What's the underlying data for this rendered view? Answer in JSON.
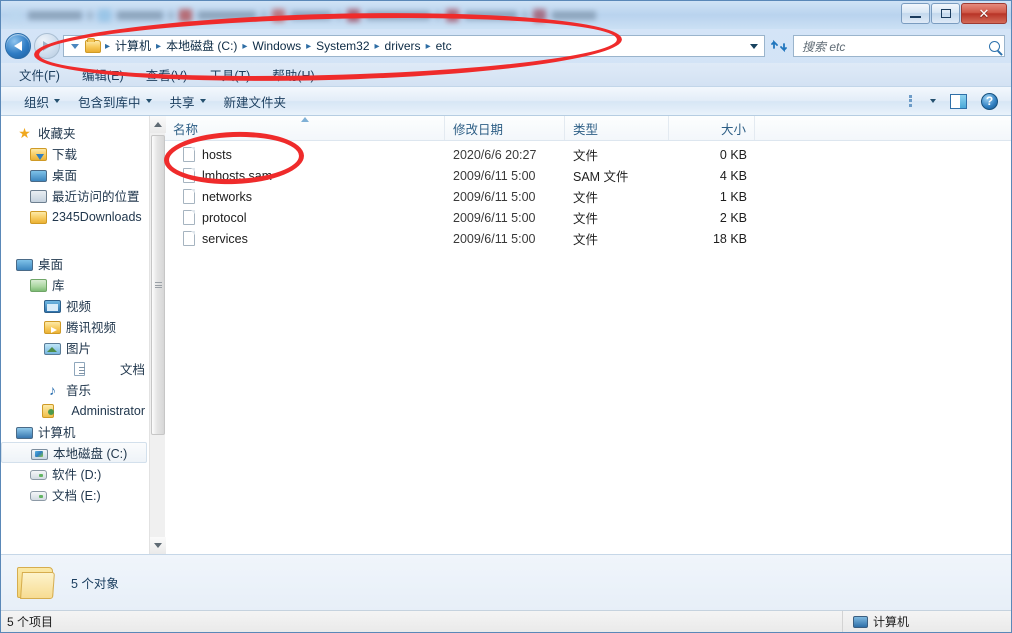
{
  "window": {
    "controls": {
      "minimize": "–",
      "maximize": "□",
      "close": "✕"
    }
  },
  "address": {
    "back_title": "后退",
    "forward_title": "前进",
    "crumbs": [
      "计算机",
      "本地磁盘 (C:)",
      "Windows",
      "System32",
      "drivers",
      "etc"
    ],
    "separator": "▸",
    "refresh_icon": "↻"
  },
  "search": {
    "placeholder": "搜索 etc",
    "icon": "search-icon"
  },
  "menubar": {
    "items": [
      {
        "label": "文件(F)",
        "text": "文件(F)"
      },
      {
        "label": "编辑(E)",
        "text": "编辑(E)"
      },
      {
        "label": "查看(V)",
        "text": "查看(V)"
      },
      {
        "label": "工具(T)",
        "text": "工具(T)"
      },
      {
        "label": "帮助(H)",
        "text": "帮助(H)"
      }
    ]
  },
  "toolbar": {
    "organize": "组织",
    "include_library": "包含到库中",
    "share": "共享",
    "new_folder": "新建文件夹",
    "views_icon": "list-view-icon",
    "preview_icon": "preview-pane-icon",
    "help_icon": "?"
  },
  "navpane": {
    "items": [
      {
        "label": "收藏夹",
        "icon": "star-icon",
        "indent": 10,
        "selected": false
      },
      {
        "label": "下载",
        "icon": "download-folder-icon",
        "indent": 24,
        "selected": false
      },
      {
        "label": "桌面",
        "icon": "desktop-icon",
        "indent": 24,
        "selected": false
      },
      {
        "label": "最近访问的位置",
        "icon": "recent-places-icon",
        "indent": 24,
        "selected": false
      },
      {
        "label": "2345Downloads",
        "icon": "folder-icon",
        "indent": 24,
        "selected": false
      },
      {
        "label": "",
        "icon": "spacer",
        "indent": 0,
        "selected": false
      },
      {
        "label": "桌面",
        "icon": "desktop-icon",
        "indent": 10,
        "selected": false
      },
      {
        "label": "库",
        "icon": "library-folder-icon",
        "indent": 24,
        "selected": false
      },
      {
        "label": "视频",
        "icon": "video-icon",
        "indent": 38,
        "selected": false
      },
      {
        "label": "腾讯视频",
        "icon": "tencent-video-icon",
        "indent": 38,
        "selected": false
      },
      {
        "label": "图片",
        "icon": "pictures-icon",
        "indent": 38,
        "selected": false
      },
      {
        "label": "文档",
        "icon": "documents-icon",
        "indent": 38,
        "selected": false
      },
      {
        "label": "音乐",
        "icon": "music-icon",
        "indent": 38,
        "selected": false
      },
      {
        "label": "Administrator",
        "icon": "user-icon",
        "indent": 24,
        "selected": false
      },
      {
        "label": "计算机",
        "icon": "computer-icon",
        "indent": 10,
        "selected": false
      },
      {
        "label": "本地磁盘 (C:)",
        "icon": "windows-drive-icon",
        "indent": 24,
        "selected": true
      },
      {
        "label": "软件 (D:)",
        "icon": "drive-icon",
        "indent": 24,
        "selected": false
      },
      {
        "label": "文档 (E:)",
        "icon": "drive-icon",
        "indent": 24,
        "selected": false
      }
    ]
  },
  "filelist": {
    "columns": [
      {
        "key": "name",
        "label": "名称",
        "sorted": true
      },
      {
        "key": "date",
        "label": "修改日期",
        "sorted": false
      },
      {
        "key": "type",
        "label": "类型",
        "sorted": false
      },
      {
        "key": "size",
        "label": "大小",
        "sorted": false
      }
    ],
    "rows": [
      {
        "name": "hosts",
        "date": "2020/6/6 20:27",
        "type": "文件",
        "size": "0 KB"
      },
      {
        "name": "lmhosts.sam",
        "date": "2009/6/11 5:00",
        "type": "SAM 文件",
        "size": "4 KB"
      },
      {
        "name": "networks",
        "date": "2009/6/11 5:00",
        "type": "文件",
        "size": "1 KB"
      },
      {
        "name": "protocol",
        "date": "2009/6/11 5:00",
        "type": "文件",
        "size": "2 KB"
      },
      {
        "name": "services",
        "date": "2009/6/11 5:00",
        "type": "文件",
        "size": "18 KB"
      }
    ]
  },
  "details": {
    "text": "5 个对象",
    "icon": "folder-icon"
  },
  "statusbar": {
    "left": "5 个项目",
    "right": "计算机",
    "right_icon": "computer-icon"
  },
  "annotations": {
    "accent_color": "#ef2b2b",
    "shapes": [
      {
        "name": "address-bar-highlight",
        "target": "地址栏"
      },
      {
        "name": "hosts-file-highlight",
        "target": "hosts"
      }
    ]
  }
}
